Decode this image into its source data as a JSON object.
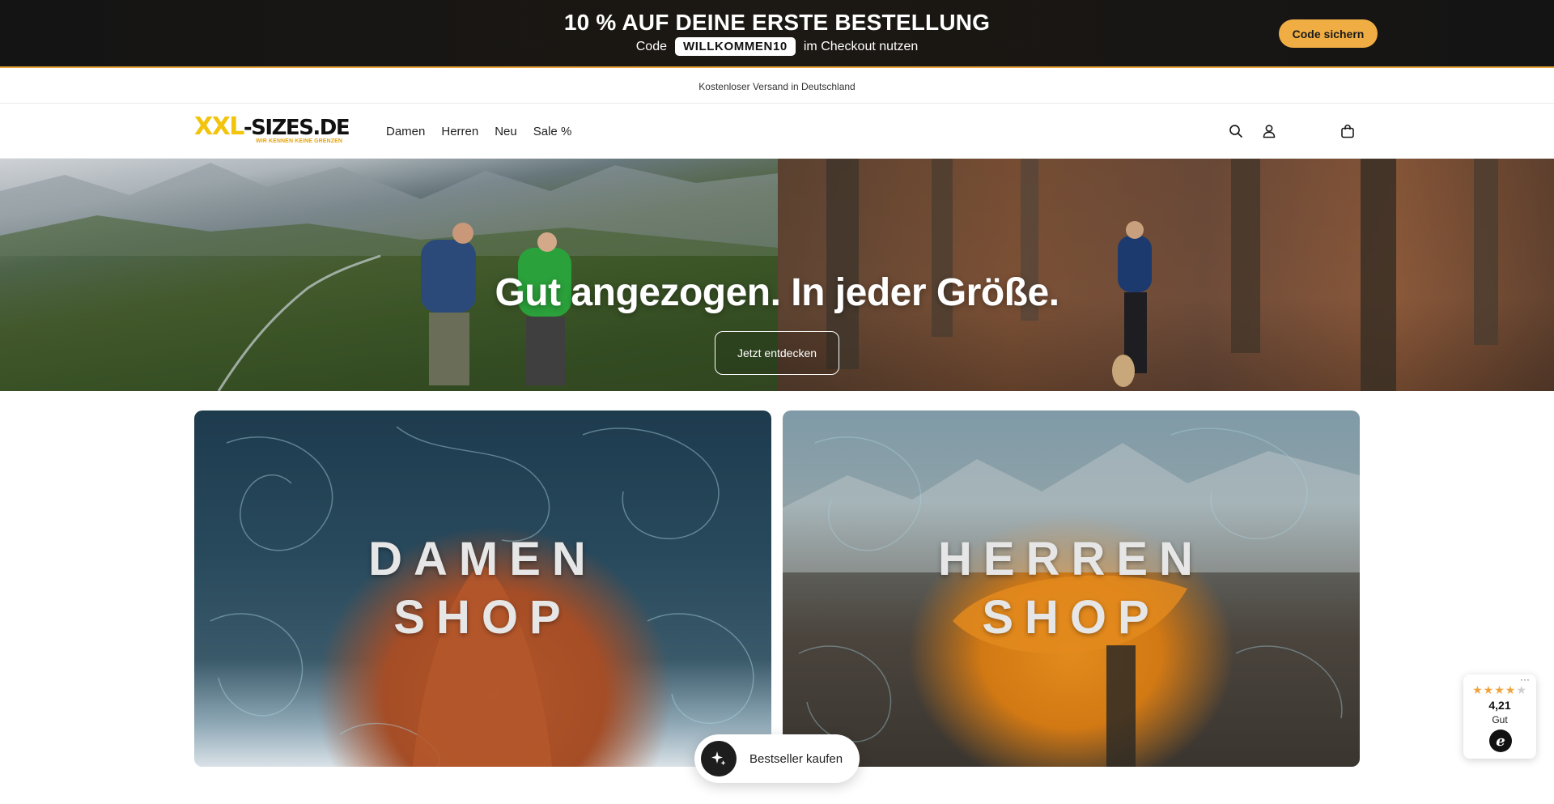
{
  "promo": {
    "title": "10 % AUF DEINE ERSTE BESTELLUNG",
    "code_prefix": "Code",
    "code": "WILLKOMMEN10",
    "code_suffix": "im Checkout nutzen",
    "button": "Code sichern"
  },
  "shipping": {
    "text": "Kostenloser Versand in Deutschland"
  },
  "header": {
    "logo_xxl": "XXL",
    "logo_rest": "-SIZES.DE",
    "logo_tagline": "WIR KENNEN KEINE GRENZEN",
    "nav": [
      "Damen",
      "Herren",
      "Neu",
      "Sale %"
    ],
    "icons": [
      "search-icon",
      "account-icon",
      "cart-icon"
    ]
  },
  "hero": {
    "title": "Gut angezogen. In jeder Größe.",
    "button": "Jetzt entdecken"
  },
  "tiles": {
    "damen": {
      "line1": "DAMEN",
      "line2": "SHOP"
    },
    "herren": {
      "line1": "HERREN",
      "line2": "SHOP"
    }
  },
  "bestseller": {
    "label": "Bestseller kaufen",
    "icon": "sparkle-icon"
  },
  "trust_badge": {
    "menu": "···",
    "stars_filled": 4,
    "stars_total": 5,
    "score": "4,21",
    "rating_word": "Gut",
    "logo_letter": "e"
  },
  "colors": {
    "accent": "#f0ad43",
    "logo_yellow": "#f2c40e",
    "promo_bg": "#141414"
  }
}
